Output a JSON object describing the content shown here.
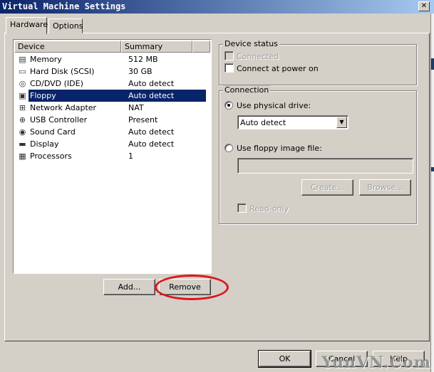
{
  "window": {
    "title": "Virtual Machine Settings",
    "close_glyph": "✕"
  },
  "tabs": [
    {
      "label": "Hardware",
      "active": true
    },
    {
      "label": "Options",
      "active": false
    }
  ],
  "device_list": {
    "columns": [
      "Device",
      "Summary"
    ],
    "rows": [
      {
        "icon": "memory-icon",
        "glyph": "▤",
        "device": "Memory",
        "summary": "512 MB"
      },
      {
        "icon": "hard-disk-icon",
        "glyph": "▭",
        "device": "Hard Disk (SCSI)",
        "summary": "30 GB"
      },
      {
        "icon": "cd-dvd-icon",
        "glyph": "◎",
        "device": "CD/DVD (IDE)",
        "summary": "Auto detect"
      },
      {
        "icon": "floppy-icon",
        "glyph": "▣",
        "device": "Floppy",
        "summary": "Auto detect",
        "selected": true
      },
      {
        "icon": "network-adapter-icon",
        "glyph": "⊞",
        "device": "Network Adapter",
        "summary": "NAT"
      },
      {
        "icon": "usb-controller-icon",
        "glyph": "⊕",
        "device": "USB Controller",
        "summary": "Present"
      },
      {
        "icon": "sound-card-icon",
        "glyph": "◉",
        "device": "Sound Card",
        "summary": "Auto detect"
      },
      {
        "icon": "display-icon",
        "glyph": "▬",
        "device": "Display",
        "summary": "Auto detect"
      },
      {
        "icon": "processors-icon",
        "glyph": "▦",
        "device": "Processors",
        "summary": "1"
      }
    ]
  },
  "buttons": {
    "add": "Add...",
    "remove": "Remove",
    "ok": "OK",
    "cancel": "Cancel",
    "help": "Help",
    "create": "Create...",
    "browse": "Browse..."
  },
  "device_status": {
    "title": "Device status",
    "connected": "Connected",
    "connected_checked": false,
    "connected_enabled": false,
    "connect_at_power_on": "Connect at power on",
    "connect_at_power_on_checked": false
  },
  "connection": {
    "title": "Connection",
    "use_physical_drive": "Use physical drive:",
    "physical_drive_selected": true,
    "drive_value": "Auto detect",
    "use_floppy_image": "Use floppy image file:",
    "floppy_image_value": "",
    "read_only": "Read-only",
    "read_only_checked": false
  },
  "annotation_color": "#e0141e",
  "watermark": "YunVN.Com"
}
